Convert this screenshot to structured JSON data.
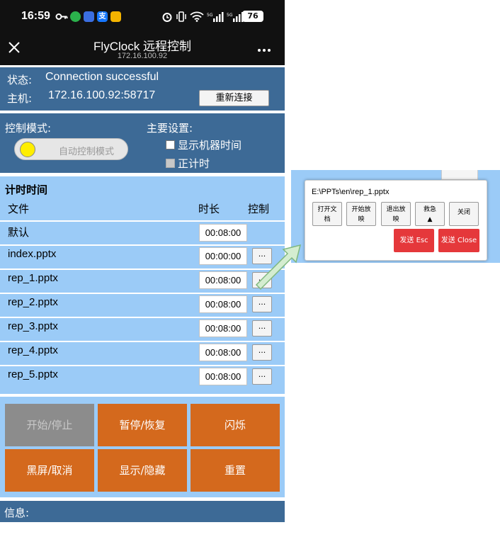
{
  "status_bar": {
    "time": "16:59",
    "battery": "76"
  },
  "titlebar": {
    "title": "FlyClock 远程控制",
    "subtitle": "172.16.100.92"
  },
  "connection": {
    "status_label": "状态:",
    "status_value": "Connection successful",
    "host_label": "主机:",
    "host_value": "172.16.100.92:58717",
    "reconnect_label": "重新连接"
  },
  "mode": {
    "mode_label": "控制模式:",
    "toggle_label": "自动控制模式",
    "settings_label": "主要设置:",
    "show_time_label": "显示机器时间",
    "count_up_label": "正计时"
  },
  "timer": {
    "title": "计时时间",
    "col_file": "文件",
    "col_duration": "时长",
    "col_control": "控制",
    "rows": [
      {
        "file": "默认",
        "duration": "00:08:00",
        "control": ""
      },
      {
        "file": "index.pptx",
        "duration": "00:00:00",
        "control": "..."
      },
      {
        "file": "rep_1.pptx",
        "duration": "00:08:00",
        "control": "..."
      },
      {
        "file": "rep_2.pptx",
        "duration": "00:08:00",
        "control": "..."
      },
      {
        "file": "rep_3.pptx",
        "duration": "00:08:00",
        "control": "..."
      },
      {
        "file": "rep_4.pptx",
        "duration": "00:08:00",
        "control": "..."
      },
      {
        "file": "rep_5.pptx",
        "duration": "00:08:00",
        "control": "..."
      }
    ]
  },
  "actions": {
    "start_stop": "开始/停止",
    "pause_resume": "暂停/恢复",
    "flash": "闪烁",
    "blackout": "黑屏/取消",
    "show_hide": "显示/隐藏",
    "reset": "重置"
  },
  "info": {
    "label": "信息:"
  },
  "popup": {
    "path": "E:\\PPTs\\en\\rep_1.pptx",
    "open_doc_line1": "打开文",
    "open_doc_line2": "档",
    "start_show_line1": "开始放",
    "start_show_line2": "映",
    "exit_show_line1": "退出放",
    "exit_show_line2": "映",
    "emergency_line1": "救急",
    "emergency_line2": "▲",
    "close": "关闭",
    "send_esc": "发送 Esc",
    "send_close": "发送 Close"
  },
  "colors": {
    "dark_panel": "#3d6a96",
    "light_panel": "#9bcbf7",
    "action_orange": "#d4691d",
    "disabled_gray": "#8c8c8c",
    "send_red": "#e5383b",
    "arrow_green": "#d4edd0"
  },
  "icons": [
    "close-icon",
    "more-icon",
    "key-icon",
    "wechat-icon",
    "alipay-icon",
    "alarm-icon",
    "wifi-icon",
    "signal-icon",
    "battery-icon",
    "pointer-arrow-icon"
  ]
}
